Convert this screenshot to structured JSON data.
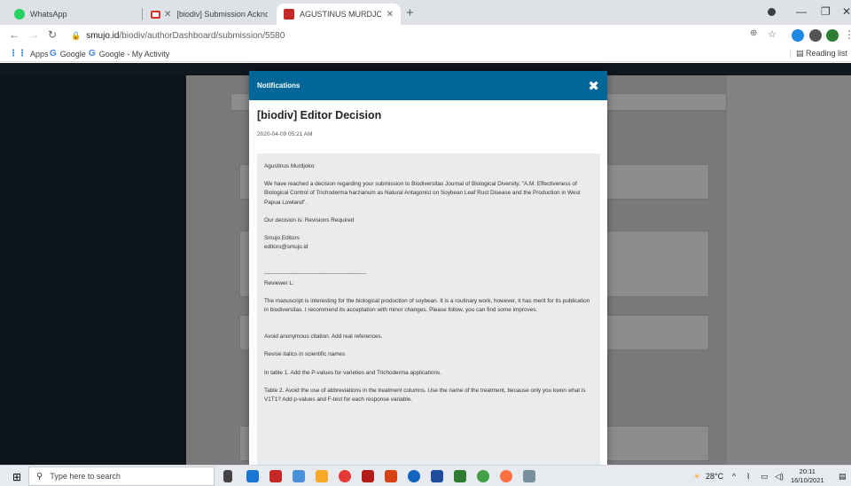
{
  "browser": {
    "tabs": [
      {
        "title": "WhatsApp",
        "active": false
      },
      {
        "title": "[biodiv] Submission Acknowledg",
        "active": false
      },
      {
        "title": "AGUSTINUS MURDJOKO, Effectiv",
        "active": true
      }
    ],
    "url_host": "smujo.id",
    "url_path": "/biodiv/authorDashboard/submission/5580",
    "bookmarks": [
      {
        "label": "Apps"
      },
      {
        "label": "Google"
      },
      {
        "label": "Google - My Activity"
      }
    ],
    "reading_list": "Reading list"
  },
  "modal": {
    "header": "Notifications",
    "subject": "[biodiv] Editor Decision",
    "date": "2020-04-09 05:21 AM",
    "body": [
      "Agustinus Murdjoko:",
      "We have reached a decision regarding your submission to Biodiversitas Journal of Biological Diversity, \"A.M. Effectiveness of Biological Control of Trichoderma harzianum as Natural Antagonist on Soybean Leaf Rust Disease and the Production in West Papua Lowland\".",
      "Our decision is: Revisions Required",
      "Smujo Editors",
      "editors@smujo.id",
      "------------------------------------------------------",
      "Reviewer L:",
      "The manuscript is interesting for the biological production of soybean. It is a routinary work, however, it has merit for its publication in biodiversitas. I recommend its acceptation with minor changes. Please follow, you can find some improves.",
      "Avoid anonymous citation. Add real references.",
      "Revise italics in scientific names",
      "In table 1. Add the P-values for varieties and Trichoderma applications.",
      "Table 2. Avoid the use of abbreviations in the treatment columns. Use the name of the treatment, because only you kwon what is V1T1? Add p-values and F-test for each response variable."
    ]
  },
  "taskbar": {
    "search_placeholder": "Type here to search",
    "weather": "28°C",
    "time": "20:11",
    "date": "16/10/2021"
  },
  "colors": {
    "modal_header": "#006798",
    "tab_bar": "#dee1e6",
    "page_sidebar": "#1b2633"
  }
}
